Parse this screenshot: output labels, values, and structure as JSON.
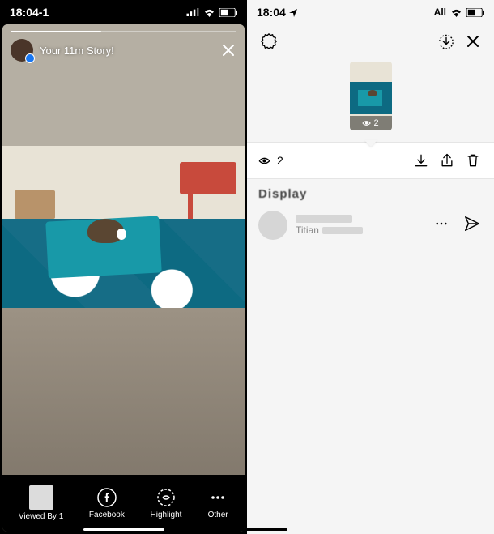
{
  "left": {
    "status": {
      "time": "18:04-1"
    },
    "story": {
      "title": "Your 11m Story!",
      "footer": {
        "viewed_label": "Viewed By",
        "viewed_count": "1",
        "facebook_label": "Facebook",
        "highlight_label": "Highlight",
        "other_label": "Other"
      }
    }
  },
  "right": {
    "status": {
      "time": "18:04",
      "signal_label": "All"
    },
    "thumb_view_count": "2",
    "views_count": "2",
    "section_label": "Display",
    "viewer": {
      "subname": "Titian"
    }
  }
}
